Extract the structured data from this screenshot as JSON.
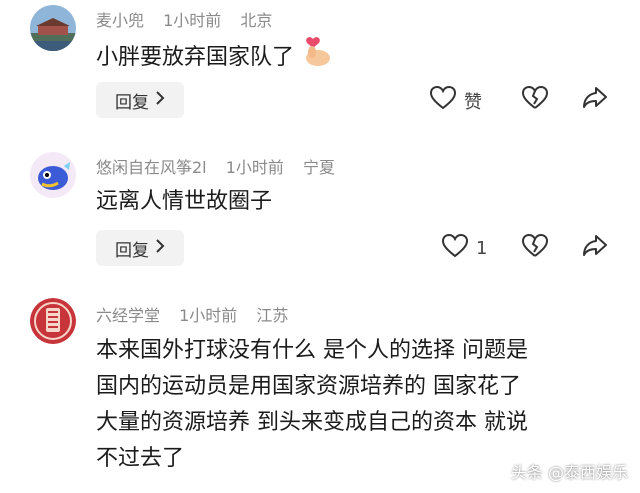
{
  "comments": [
    {
      "username": "麦小兜",
      "time": "1小时前",
      "location": "北京",
      "text": "小胖要放弃国家队了",
      "reply_label": "回复",
      "like_label": "赞",
      "like_count": ""
    },
    {
      "username": "悠闲自在风筝2l",
      "time": "1小时前",
      "location": "宁夏",
      "text": "远离人情世故圈子",
      "reply_label": "回复",
      "like_label": "",
      "like_count": "1"
    },
    {
      "username": "六经学堂",
      "time": "1小时前",
      "location": "江苏",
      "text_lines": [
        "本来国外打球没有什么 是个人的选择 问题是",
        "国内的运动员是用国家资源培养的 国家花了",
        "大量的资源培养 到头来变成自己的资本 就说",
        "不过去了"
      ]
    }
  ],
  "watermark": "头条 @泰西娱乐",
  "colors": {
    "meta": "#8a8a8a",
    "reply_bg": "#f2f2f2",
    "text": "#1b1b1b"
  },
  "icons": [
    "heart-outline-icon",
    "broken-heart-icon",
    "share-arrow-icon",
    "chevron-right-icon",
    "finger-heart-emoji"
  ]
}
